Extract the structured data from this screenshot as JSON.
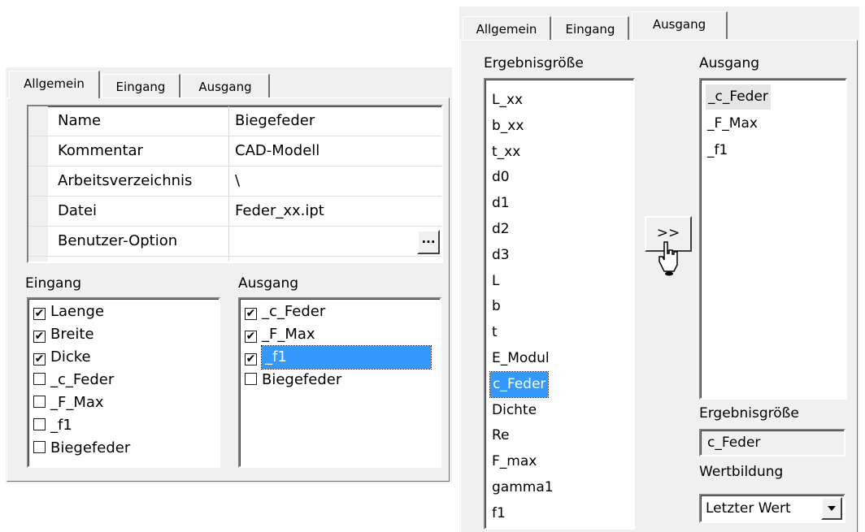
{
  "left": {
    "tabs": [
      "Allgemein",
      "Eingang",
      "Ausgang"
    ],
    "properties": [
      {
        "name": "Name",
        "value": "Biegefeder"
      },
      {
        "name": "Kommentar",
        "value": "CAD-Modell"
      },
      {
        "name": "Arbeitsverzeichnis",
        "value": "\\"
      },
      {
        "name": "Datei",
        "value": "Feder_xx.ipt"
      },
      {
        "name": "Benutzer-Option",
        "value": ""
      }
    ],
    "browse_label": "...",
    "eingang_label": "Eingang",
    "ausgang_label": "Ausgang",
    "eingang_items": [
      {
        "label": "Laenge",
        "checked": true
      },
      {
        "label": "Breite",
        "checked": true
      },
      {
        "label": "Dicke",
        "checked": true
      },
      {
        "label": "_c_Feder",
        "checked": false
      },
      {
        "label": "_F_Max",
        "checked": false
      },
      {
        "label": "_f1",
        "checked": false
      },
      {
        "label": "Biegefeder",
        "checked": false
      }
    ],
    "ausgang_items": [
      {
        "label": "_c_Feder",
        "checked": true
      },
      {
        "label": "_F_Max",
        "checked": true
      },
      {
        "label": "_f1",
        "checked": true,
        "selected": true
      },
      {
        "label": "Biegefeder",
        "checked": false
      }
    ]
  },
  "right": {
    "tabs": [
      "Allgemein",
      "Eingang",
      "Ausgang"
    ],
    "ergebnis_label": "Ergebnisgröße",
    "ausgang_label": "Ausgang",
    "ergebnis_items": [
      "L_xx",
      "b_xx",
      "t_xx",
      "d0",
      "d1",
      "d2",
      "d3",
      "L",
      "b",
      "t",
      "E_Modul",
      "c_Feder",
      "Dichte",
      "Re",
      "F_max",
      "gamma1",
      "f1"
    ],
    "selected_index": 11,
    "ausgang_items": [
      "_c_Feder",
      "_F_Max",
      "_f1"
    ],
    "move_button": ">>",
    "ergebnis_field_label": "Ergebnisgröße",
    "ergebnis_field_value": "c_Feder",
    "wertbildung_label": "Wertbildung",
    "wertbildung_value": "Letzter Wert"
  },
  "colors": {
    "selection": "#3399ff",
    "panel": "#f0f0f0"
  }
}
